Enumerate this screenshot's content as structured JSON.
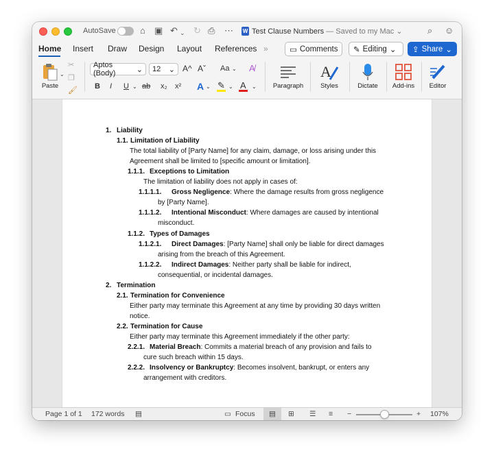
{
  "titlebar": {
    "autosave_label": "AutoSave",
    "doc_title": "Test Clause Numbers",
    "doc_status": "— Saved to my Mac"
  },
  "tabs": [
    {
      "label": "Home"
    },
    {
      "label": "Insert"
    },
    {
      "label": "Draw"
    },
    {
      "label": "Design"
    },
    {
      "label": "Layout"
    },
    {
      "label": "References"
    }
  ],
  "header_buttons": {
    "comments": "Comments",
    "editing": "Editing",
    "share": "Share"
  },
  "ribbon": {
    "paste": "Paste",
    "font_name": "Aptos (Body)",
    "font_size": "12",
    "paragraph": "Paragraph",
    "styles": "Styles",
    "dictate": "Dictate",
    "addins": "Add-ins",
    "editor": "Editor",
    "bold": "B",
    "italic": "I",
    "underline": "U",
    "strike": "ab",
    "subscript": "x₂",
    "superscript": "x²",
    "grow": "A^",
    "shrink": "Aˇ",
    "case": "Aa",
    "accent_color": "#1e66d0",
    "highlight_color": "#ffe600",
    "font_color": "#e01e1e"
  },
  "document": {
    "lines": [
      {
        "num": "1.",
        "bold": "Liability",
        "text": ""
      },
      {
        "num": "1.1.",
        "bold": "Limitation of Liability",
        "text": ""
      },
      {
        "num": "",
        "bold": "",
        "text": "The total liability of [Party Name] for any claim, damage, or loss arising under this"
      },
      {
        "num": "",
        "bold": "",
        "text": "Agreement shall be limited to [specific amount or limitation]."
      },
      {
        "num": "1.1.1.",
        "bold": "Exceptions to Limitation",
        "text": ""
      },
      {
        "num": "",
        "bold": "",
        "text": "The limitation of liability does not apply in cases of:"
      },
      {
        "num": "1.1.1.1.",
        "bold": "Gross Negligence",
        "text": ": Where the damage results from gross negligence"
      },
      {
        "num": "",
        "bold": "",
        "text": "by [Party Name]."
      },
      {
        "num": "1.1.1.2.",
        "bold": "Intentional Misconduct",
        "text": ": Where damages are caused by intentional"
      },
      {
        "num": "",
        "bold": "",
        "text": "misconduct."
      },
      {
        "num": "1.1.2.",
        "bold": "Types of Damages",
        "text": ""
      },
      {
        "num": "1.1.2.1.",
        "bold": "Direct Damages",
        "text": ": [Party Name] shall only be liable for direct damages"
      },
      {
        "num": "",
        "bold": "",
        "text": "arising from the breach of this Agreement."
      },
      {
        "num": "1.1.2.2.",
        "bold": "Indirect Damages",
        "text": ": Neither party shall be liable for indirect,"
      },
      {
        "num": "",
        "bold": "",
        "text": "consequential, or incidental damages."
      },
      {
        "num": "2.",
        "bold": "Termination",
        "text": ""
      },
      {
        "num": "2.1.",
        "bold": "Termination for Convenience",
        "text": ""
      },
      {
        "num": "",
        "bold": "",
        "text": "Either party may terminate this Agreement at any time by providing 30 days written"
      },
      {
        "num": "",
        "bold": "",
        "text": "notice."
      },
      {
        "num": "2.2.",
        "bold": "Termination for Cause",
        "text": ""
      },
      {
        "num": "",
        "bold": "",
        "text": "Either party may terminate this Agreement immediately if the other party:"
      },
      {
        "num": "2.2.1.",
        "bold": "Material Breach",
        "text": ": Commits a material breach of any provision and fails to"
      },
      {
        "num": "",
        "bold": "",
        "text": "cure such breach within 15 days."
      },
      {
        "num": "2.2.2.",
        "bold": "Insolvency or Bankruptcy",
        "text": ": Becomes insolvent, bankrupt, or enters any"
      },
      {
        "num": "",
        "bold": "",
        "text": "arrangement with creditors."
      }
    ]
  },
  "status": {
    "page": "Page 1 of 1",
    "words": "172 words",
    "focus": "Focus",
    "zoom": "107%",
    "zoom_level_percent": 107
  }
}
